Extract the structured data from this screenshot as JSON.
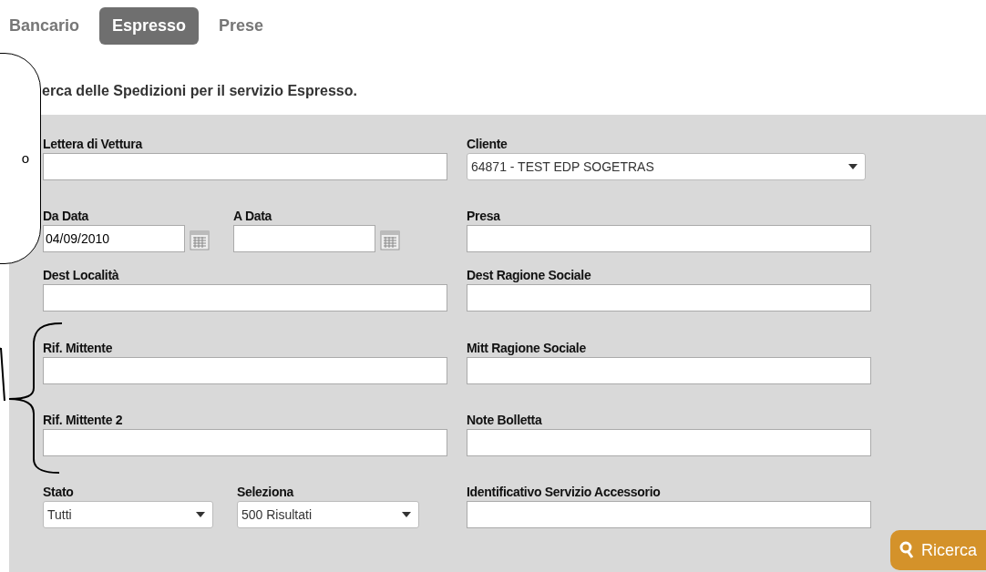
{
  "tabs": [
    {
      "label": "Bancario",
      "selected": false
    },
    {
      "label": "Espresso",
      "selected": true
    },
    {
      "label": "Prese",
      "selected": false
    }
  ],
  "heading": "erca delle Spedizioni per il servizio Espresso.",
  "callout": {
    "text": "o"
  },
  "form": {
    "rows": [
      {
        "left": [
          {
            "kind": "text",
            "label": "Lettera di Vettura"
          }
        ],
        "right": [
          {
            "kind": "select",
            "label": "Cliente",
            "value": "64871 - TEST EDP SOGETRAS"
          }
        ]
      },
      {
        "left": [
          {
            "kind": "date",
            "label": "Da Data",
            "value": "04/09/2010"
          },
          {
            "kind": "date",
            "label": "A Data"
          }
        ],
        "right": [
          {
            "kind": "text",
            "label": "Presa"
          }
        ]
      },
      {
        "left": [
          {
            "kind": "text",
            "label": "Dest Località"
          }
        ],
        "right": [
          {
            "kind": "text",
            "label": "Dest Ragione Sociale"
          }
        ]
      },
      {
        "left": [
          {
            "kind": "text",
            "label": "Rif. Mittente"
          }
        ],
        "right": [
          {
            "kind": "text",
            "label": "Mitt Ragione Sociale"
          }
        ]
      },
      {
        "left": [
          {
            "kind": "text",
            "label": "Rif. Mittente 2"
          }
        ],
        "right": [
          {
            "kind": "text",
            "label": "Note Bolletta"
          }
        ]
      },
      {
        "left": [
          {
            "kind": "select",
            "label": "Stato",
            "value": "Tutti"
          },
          {
            "kind": "select",
            "label": "Seleziona",
            "value": "500 Risultati"
          }
        ],
        "right": [
          {
            "kind": "text",
            "label": "Identificativo Servizio Accessorio"
          }
        ]
      }
    ],
    "search_button": "Ricerca"
  }
}
